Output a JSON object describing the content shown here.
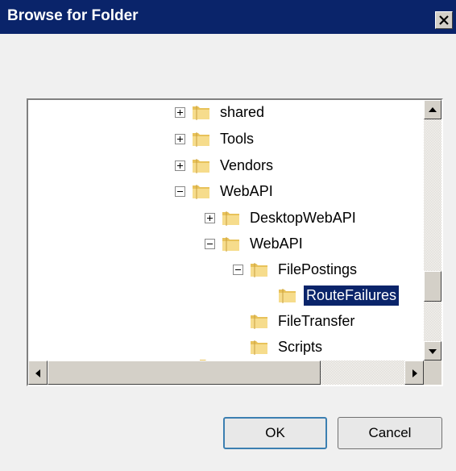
{
  "window": {
    "title": "Browse for Folder",
    "close_glyph": "✕"
  },
  "tree": {
    "nodes": [
      {
        "label": "shared",
        "toggle": "plus"
      },
      {
        "label": "Tools",
        "toggle": "plus"
      },
      {
        "label": "Vendors",
        "toggle": "plus"
      },
      {
        "label": "WebAPI",
        "toggle": "minus"
      },
      {
        "label": "DesktopWebAPI",
        "toggle": "plus"
      },
      {
        "label": "WebAPI",
        "toggle": "minus"
      },
      {
        "label": "FilePostings",
        "toggle": "minus"
      },
      {
        "label": "RouteFailures",
        "toggle": "none",
        "selected": true
      },
      {
        "label": "FileTransfer",
        "toggle": "none"
      },
      {
        "label": "Scripts",
        "toggle": "none"
      }
    ]
  },
  "buttons": {
    "ok": "OK",
    "cancel": "Cancel"
  },
  "colors": {
    "title_bar": "#0a246a",
    "selection": "#0a246a",
    "folder": "#f3d37a"
  }
}
